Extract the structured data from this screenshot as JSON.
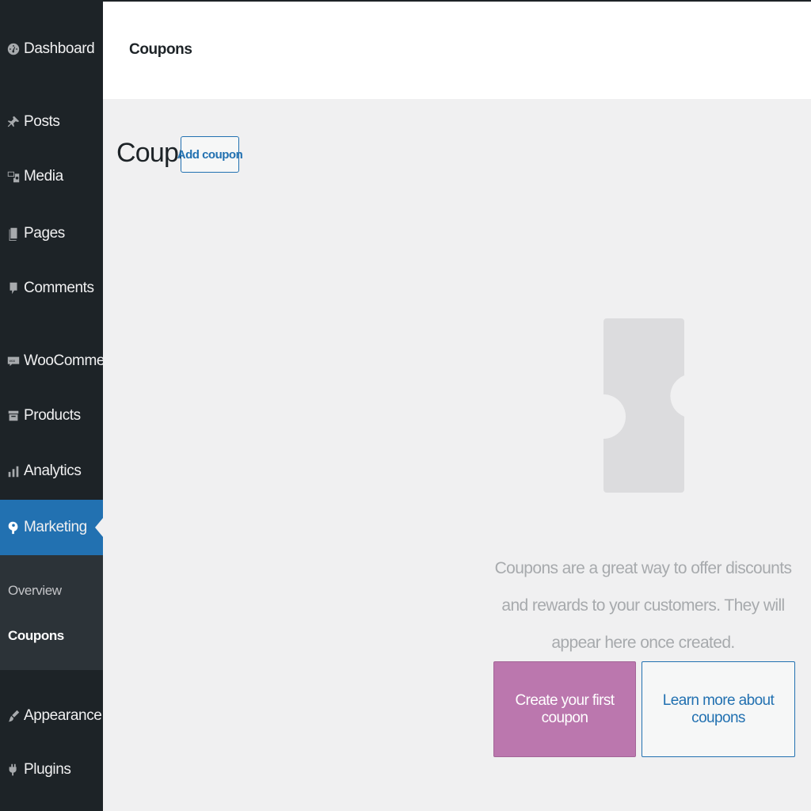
{
  "sidebar": {
    "items": [
      {
        "label": "Dashboard",
        "icon": "dashboard-icon"
      },
      {
        "label": "Posts",
        "icon": "pin-icon"
      },
      {
        "label": "Media",
        "icon": "media-icon"
      },
      {
        "label": "Pages",
        "icon": "pages-icon"
      },
      {
        "label": "Comments",
        "icon": "comment-icon"
      },
      {
        "label": "WooCommerce",
        "icon": "woo-icon"
      },
      {
        "label": "Products",
        "icon": "archive-icon"
      },
      {
        "label": "Analytics",
        "icon": "bar-chart-icon"
      },
      {
        "label": "Marketing",
        "icon": "megaphone-icon"
      },
      {
        "label": "Appearance",
        "icon": "brush-icon"
      },
      {
        "label": "Plugins",
        "icon": "plug-icon"
      }
    ],
    "active": "Marketing",
    "submenu": [
      {
        "label": "Overview"
      },
      {
        "label": "Coupons"
      }
    ],
    "submenu_current": "Coupons"
  },
  "header": {
    "title": "Coupons"
  },
  "main": {
    "heading": "Coupons",
    "add_button": "Add coupon",
    "empty_message": "Coupons are a great way to offer discounts and rewards to your customers. They will appear here once created.",
    "primary_button": "Create your first coupon",
    "secondary_button": "Learn more about coupons"
  },
  "colors": {
    "sidebar_bg": "#1d2327",
    "active_blue": "#2271b1",
    "woo_purple": "#bb77ae",
    "illustration_gray": "#dcdcde"
  }
}
